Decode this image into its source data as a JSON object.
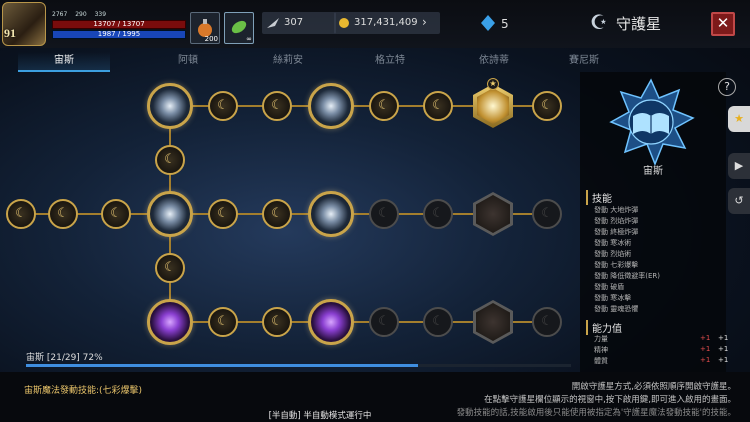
{
  "player": {
    "level": "91",
    "stat_a": "2767",
    "stat_b": "290",
    "stat_c": "339",
    "hp": "13707 / 13707",
    "mp": "1987 / 1995"
  },
  "slots": {
    "potion_count": "200",
    "leaf_count": "∞"
  },
  "currency": {
    "crystals": "307",
    "gold": "317,431,409",
    "gems": "5"
  },
  "window": {
    "title": "守護星",
    "close_label": "✕"
  },
  "tabs": [
    {
      "label": "宙斯"
    },
    {
      "label": "阿頓"
    },
    {
      "label": "絲莉安"
    },
    {
      "label": "格立特"
    },
    {
      "label": "依詩蒂"
    },
    {
      "label": "賽尼斯"
    }
  ],
  "tree": {
    "progress_text": "宙斯 [21/29] 72%",
    "progress_fraction": 0.72,
    "moon_glyph": "☾"
  },
  "constellation": {
    "name": "宙斯"
  },
  "skills": {
    "heading": "技能",
    "items": [
      "發動 大地炸彈",
      "發動 烈焰炸彈",
      "發動 終極炸彈",
      "發動 寒冰術",
      "發動 烈焰術",
      "發動 七彩爆擊",
      "發動 降低徵避率(ER)",
      "發動 破盾",
      "發動 寒冰擊",
      "發動 靈魂恐懼"
    ]
  },
  "stats": {
    "heading": "能力值",
    "items": [
      {
        "name": "力量",
        "a": "+1",
        "b": "+1"
      },
      {
        "name": "精神",
        "a": "+1",
        "b": "+1"
      },
      {
        "name": "體質",
        "a": "+1",
        "b": "+1"
      }
    ]
  },
  "bottom": {
    "magic_skill": "宙斯魔法發動技能:(七彩爆擊)",
    "info_lines": [
      "開啟守護星方式,必須依照順序開啟守護星。",
      "在點擊守護星欄位顯示的視窗中,按下啟用鍵,即可進入啟用的畫面。",
      "發動技能的話,技能啟用後只能使用被指定為'守護星魔法發動技能'的技能。"
    ],
    "auto_status": "[半自動] 半自動模式運行中"
  },
  "colors": {
    "accent": "#3c9fe0",
    "gold": "#c9a44a",
    "hp": "#7a0c0c",
    "mp": "#1846b8",
    "close": "#7d1a1a"
  }
}
